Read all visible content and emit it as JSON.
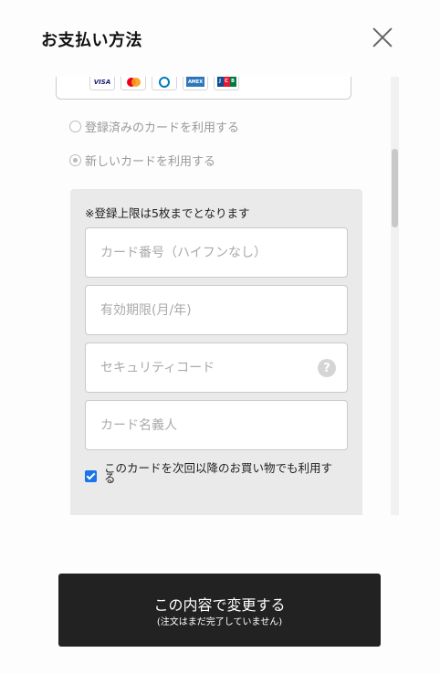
{
  "modal": {
    "title": "お支払い方法"
  },
  "card_brands": {
    "visa": "VISA",
    "amex": "AMEX",
    "jcb": [
      "J",
      "C",
      "B"
    ]
  },
  "payment_options": {
    "saved_card_label": "登録済みのカードを利用する",
    "new_card_label": "新しいカードを利用する",
    "selected": "new_card"
  },
  "card_form": {
    "notice": "※登録上限は5枚までとなります",
    "card_number_placeholder": "カード番号（ハイフンなし）",
    "expiry_placeholder": "有効期限(月/年)",
    "security_code_placeholder": "セキュリティコード",
    "security_help_label": "?",
    "card_holder_placeholder": "カード名義人",
    "save_for_future_label": "このカードを次回以降のお買い物でも利用する",
    "save_for_future_checked": true
  },
  "submit": {
    "label": "この内容で変更する",
    "sub_label": "(注文はまだ完了していません)"
  },
  "colors": {
    "button_bg": "#222222",
    "panel_bg": "#eaeaea",
    "checkbox": "#1a73e8"
  }
}
